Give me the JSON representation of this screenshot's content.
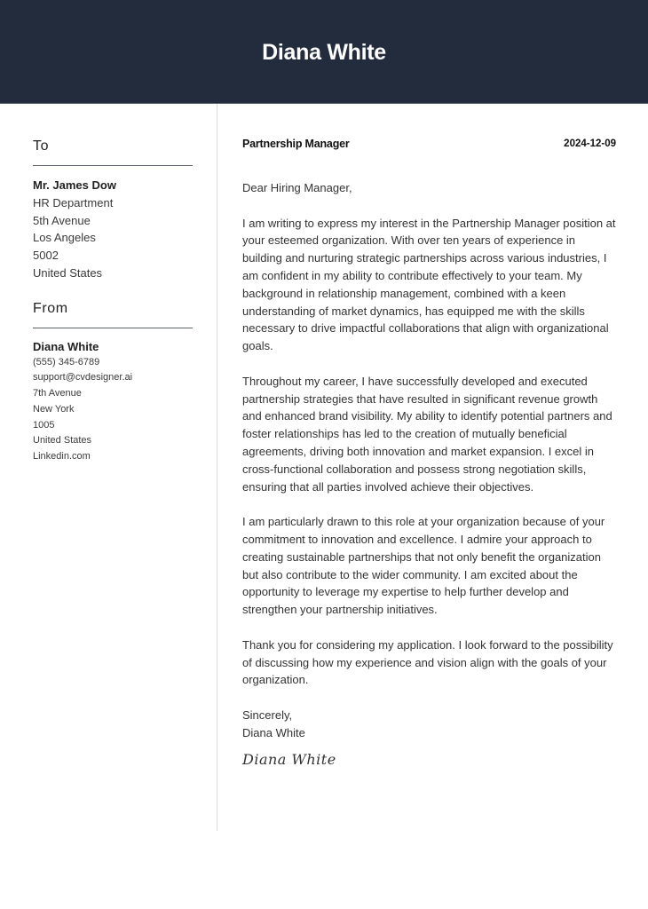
{
  "header": {
    "name": "Diana White"
  },
  "sidebar": {
    "to": {
      "heading": "To",
      "name": "Mr. James Dow",
      "lines": [
        "HR Department",
        "5th Avenue",
        "Los Angeles",
        "5002",
        "United States"
      ]
    },
    "from": {
      "heading": "From",
      "name": "Diana White",
      "lines": [
        "(555) 345-6789",
        "support@cvdesigner.ai",
        "7th Avenue",
        "New York",
        "1005",
        "United States",
        "Linkedin.com"
      ]
    }
  },
  "letter": {
    "job_title": "Partnership Manager",
    "date": "2024-12-09",
    "greeting": "Dear Hiring Manager,",
    "paragraphs": [
      "I am writing to express my interest in the Partnership Manager position at your esteemed organization. With over ten years of experience in building and nurturing strategic partnerships across various industries, I am confident in my ability to contribute effectively to your team. My background in relationship management, combined with a keen understanding of market dynamics, has equipped me with the skills necessary to drive impactful collaborations that align with organizational goals.",
      "Throughout my career, I have successfully developed and executed partnership strategies that have resulted in significant revenue growth and enhanced brand visibility. My ability to identify potential partners and foster relationships has led to the creation of mutually beneficial agreements, driving both innovation and market expansion. I excel in cross-functional collaboration and possess strong negotiation skills, ensuring that all parties involved achieve their objectives.",
      "I am particularly drawn to this role at your organization because of your commitment to innovation and excellence. I admire your approach to creating sustainable partnerships that not only benefit the organization but also contribute to the wider community. I am excited about the opportunity to leverage my expertise to help further develop and strengthen your partnership initiatives.",
      "Thank you for considering my application. I look forward to the possibility of discussing how my experience and vision align with the goals of your organization."
    ],
    "closing": "Sincerely,",
    "closing_name": "Diana White",
    "signature": "Diana White"
  }
}
